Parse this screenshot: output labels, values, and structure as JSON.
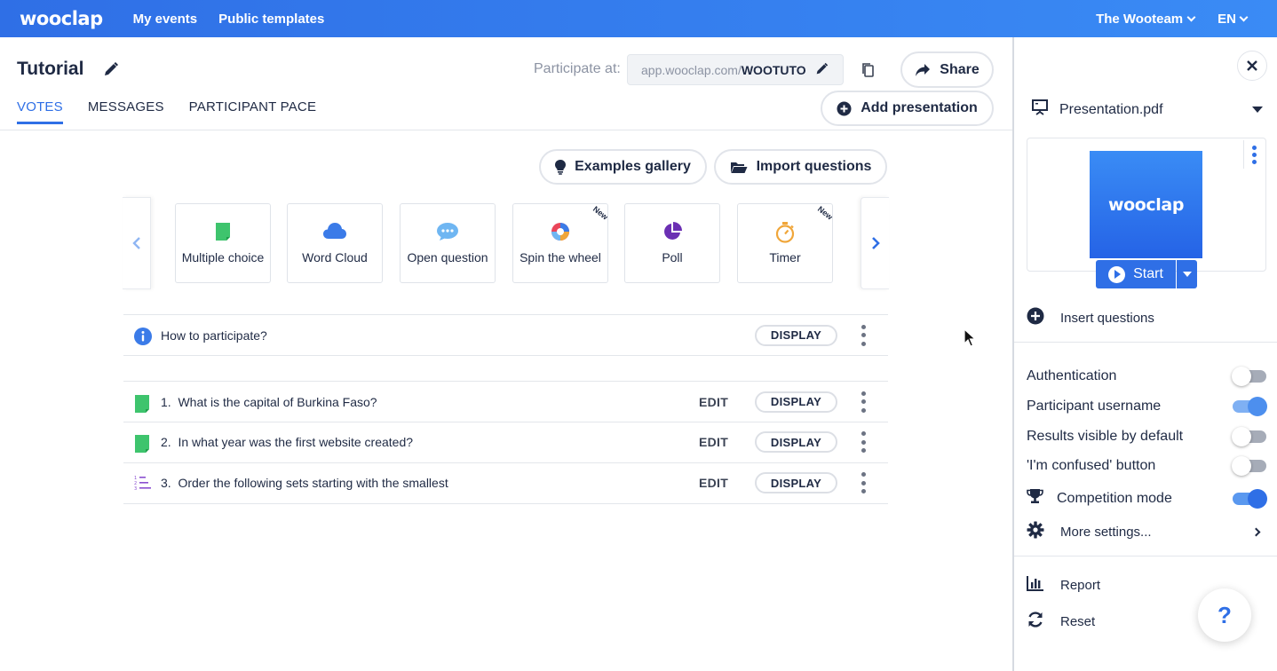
{
  "topbar": {
    "logo": "wooclap",
    "nav": [
      "My events",
      "Public templates"
    ],
    "team": "The Wooteam",
    "lang": "EN"
  },
  "event": {
    "title": "Tutorial",
    "participate_label": "Participate at:",
    "url_prefix": "app.wooclap.com/",
    "url_code": "WOOTUTO",
    "share_label": "Share",
    "add_presentation_label": "Add presentation"
  },
  "tabs": [
    {
      "label": "VOTES",
      "active": true
    },
    {
      "label": "MESSAGES",
      "active": false
    },
    {
      "label": "PARTICIPANT PACE",
      "active": false
    }
  ],
  "actions": {
    "examples_gallery": "Examples gallery",
    "import_questions": "Import questions"
  },
  "question_types": [
    {
      "label": "Multiple choice",
      "icon": "multiple-choice-icon",
      "color": "#3ec46d",
      "new": false
    },
    {
      "label": "Word Cloud",
      "icon": "cloud-icon",
      "color": "#3b7be8",
      "new": false
    },
    {
      "label": "Open question",
      "icon": "speech-bubble-icon",
      "color": "#6fb6f2",
      "new": false
    },
    {
      "label": "Spin the wheel",
      "icon": "wheel-icon",
      "color": "#e9455a",
      "new": true
    },
    {
      "label": "Poll",
      "icon": "pie-chart-icon",
      "color": "#6b2fb3",
      "new": false
    },
    {
      "label": "Timer",
      "icon": "stopwatch-icon",
      "color": "#f0a63a",
      "new": true
    }
  ],
  "new_badge": "New",
  "intro_row": {
    "text": "How to participate?",
    "display_label": "DISPLAY"
  },
  "questions": [
    {
      "number": "1.",
      "text": "What is the capital of Burkina Faso?",
      "icon": "multiple-choice-icon",
      "edit_label": "EDIT",
      "display_label": "DISPLAY"
    },
    {
      "number": "2.",
      "text": "In what year was the first website created?",
      "icon": "multiple-choice-icon",
      "edit_label": "EDIT",
      "display_label": "DISPLAY"
    },
    {
      "number": "3.",
      "text": "Order the following sets starting with the smallest",
      "icon": "sorting-icon",
      "edit_label": "EDIT",
      "display_label": "DISPLAY"
    }
  ],
  "sidebar": {
    "presentation_name": "Presentation.pdf",
    "thumbnail_text": "wooclap",
    "start_label": "Start",
    "insert_questions": "Insert questions",
    "settings": [
      {
        "label": "Authentication",
        "on": false
      },
      {
        "label": "Participant username",
        "on": true
      },
      {
        "label": "Results visible by default",
        "on": false
      },
      {
        "label": "'I'm confused' button",
        "on": false
      },
      {
        "label": "Competition mode",
        "on": true
      }
    ],
    "more_settings": "More settings...",
    "report": "Report",
    "reset": "Reset",
    "help": "?"
  },
  "colors": {
    "brand": "#2f6fe6",
    "text": "#1f2a44",
    "muted": "#8c93a3"
  }
}
